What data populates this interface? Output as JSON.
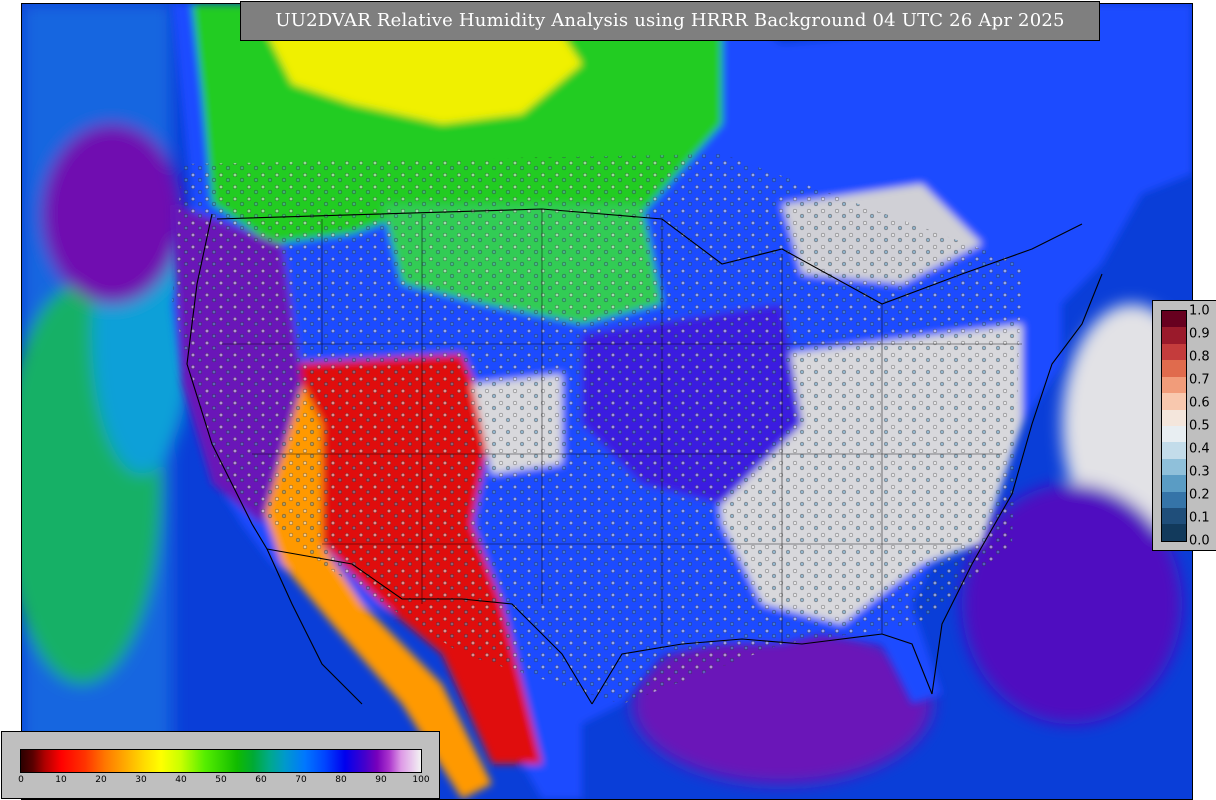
{
  "title": "UU2DVAR Relative Humidity Analysis using HRRR Background 04 UTC 26 Apr 2025",
  "rh_colorbar": {
    "ticks": [
      "0",
      "10",
      "20",
      "30",
      "40",
      "50",
      "60",
      "70",
      "80",
      "90",
      "100"
    ],
    "low_color": "#ff0000",
    "mid_color": "#11bb00",
    "high_color": "#0000ee",
    "saturated_color": "#f3f3f3"
  },
  "ob_colorbar": {
    "ticks": [
      "1.0",
      "0.9",
      "0.8",
      "0.7",
      "0.6",
      "0.5",
      "0.4",
      "0.3",
      "0.2",
      "0.1",
      "0.0"
    ],
    "colors": [
      "#67001f",
      "#9a1a2b",
      "#c43c3c",
      "#e06b4d",
      "#f19c7a",
      "#f8c8ae",
      "#f4e6dc",
      "#e8eef2",
      "#c3dcea",
      "#8fc0da",
      "#5a9cc4",
      "#3574a8",
      "#1f4e7a",
      "#123a5c"
    ]
  },
  "ocean_color": "#0a3ed8",
  "land_colors": {
    "arid": "#e01010",
    "dry": "#ffaa00",
    "moderate": "#22cc22",
    "moist": "#1a4cff",
    "humid": "#6a14b8",
    "saturated": "#d8d8dc"
  }
}
